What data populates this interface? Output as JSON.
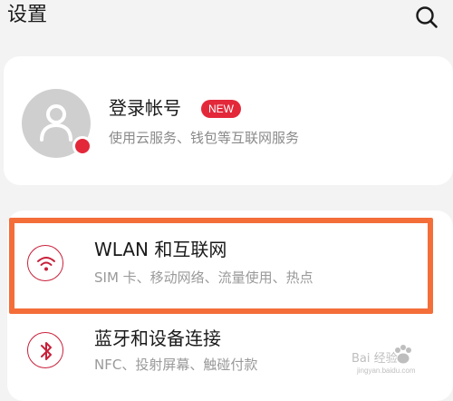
{
  "header": {
    "title": "设置",
    "search_icon": "search-icon"
  },
  "account": {
    "title": "登录帐号",
    "badge": "NEW",
    "subtitle": "使用云服务、钱包等互联网服务",
    "avatar_icon": "person-icon"
  },
  "settings": {
    "items": [
      {
        "title": "WLAN 和互联网",
        "subtitle": "SIM 卡、移动网络、流量使用、热点",
        "icon": "wifi-icon"
      },
      {
        "title": "蓝牙和设备连接",
        "subtitle": "NFC、投射屏幕、触碰付款",
        "icon": "bluetooth-icon"
      }
    ]
  },
  "watermark": {
    "text": "Bai 经验",
    "url": "jingyan.baidu.com"
  },
  "colors": {
    "accent": "#c8203a",
    "badge": "#e3283a",
    "highlight": "#f46e3a",
    "background": "#f3f3f3"
  }
}
